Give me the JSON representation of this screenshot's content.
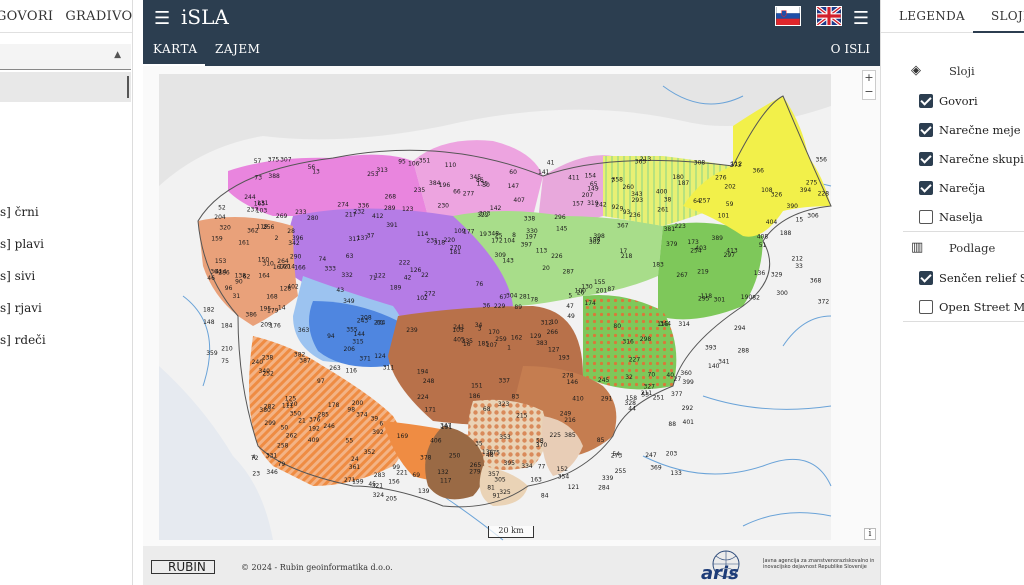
{
  "left_panel": {
    "tabs": [
      "GOVORI",
      "GRADIVO"
    ],
    "legend_items": [
      "s] črni",
      "s] plavi",
      "s] sivi",
      "s] rjavi",
      "s] rdeči"
    ]
  },
  "header": {
    "title": "iSLA",
    "tabs": [
      "KARTA",
      "ZAJEM"
    ],
    "about": "O ISLI"
  },
  "map": {
    "zoom_in": "+",
    "zoom_out": "−",
    "scale_label": "20 km",
    "info": "i",
    "region_colors": {
      "pink": "#e879dc",
      "violet": "#b57ce6",
      "blue": "#4f86e0",
      "lightblue": "#9cc3f0",
      "green": "#7ec85a",
      "lightgreen": "#a8dd8a",
      "yellow": "#f2f04a",
      "brown": "#b8714a",
      "orange": "#ef8c43",
      "salmon": "#e9a17a",
      "tan": "#ead3b6",
      "darkbrown": "#9a6a45"
    },
    "points": [
      "1",
      "2",
      "3",
      "4",
      "5",
      "6",
      "7",
      "8",
      "9",
      "10",
      "13",
      "14",
      "15",
      "16",
      "17",
      "19",
      "20",
      "21",
      "22",
      "23",
      "24",
      "25",
      "26",
      "27",
      "28",
      "30",
      "31",
      "32",
      "33",
      "34",
      "35",
      "36",
      "37",
      "38",
      "39",
      "40",
      "41",
      "42",
      "43",
      "44",
      "45",
      "46",
      "47",
      "48",
      "49",
      "50",
      "51",
      "52",
      "53",
      "54",
      "55",
      "56",
      "57",
      "58",
      "59",
      "60",
      "61",
      "62",
      "63",
      "64",
      "65",
      "66",
      "67",
      "68",
      "69",
      "70",
      "71",
      "72",
      "73",
      "74",
      "75",
      "76",
      "77",
      "78",
      "79",
      "80",
      "81",
      "82",
      "83",
      "84",
      "85",
      "86",
      "87",
      "88",
      "89",
      "90",
      "91",
      "92",
      "93",
      "94",
      "95",
      "96",
      "97",
      "98",
      "99",
      "100",
      "101",
      "102",
      "103",
      "104",
      "105",
      "106",
      "107",
      "108",
      "109",
      "110",
      "111",
      "112",
      "113",
      "114",
      "115",
      "116",
      "117",
      "118",
      "119",
      "120",
      "121",
      "122",
      "123",
      "124",
      "125",
      "126",
      "127",
      "128",
      "129",
      "130",
      "131",
      "132",
      "133",
      "134",
      "135",
      "136",
      "137",
      "138",
      "139",
      "140",
      "141",
      "142",
      "143",
      "144",
      "145",
      "146",
      "147",
      "148",
      "149",
      "150",
      "151",
      "152",
      "153",
      "154",
      "155",
      "156",
      "157",
      "158",
      "159",
      "160",
      "161",
      "162",
      "163",
      "164",
      "165",
      "166",
      "167",
      "168",
      "169",
      "170",
      "171",
      "172",
      "173",
      "174",
      "175",
      "176",
      "177",
      "178",
      "179",
      "180",
      "181",
      "182",
      "183",
      "184",
      "185",
      "186",
      "187",
      "188",
      "189",
      "190",
      "191",
      "192",
      "193",
      "194",
      "195",
      "196",
      "197",
      "198",
      "199",
      "200",
      "201",
      "202",
      "203",
      "204",
      "205",
      "206",
      "207",
      "208",
      "209",
      "210",
      "211",
      "212",
      "213",
      "214",
      "215",
      "216",
      "217",
      "218",
      "219",
      "220",
      "221",
      "222",
      "223",
      "224",
      "225",
      "226",
      "227",
      "228",
      "229",
      "230",
      "231",
      "232",
      "233",
      "234",
      "235",
      "236",
      "237",
      "238",
      "239",
      "240",
      "241",
      "242",
      "243",
      "244",
      "245",
      "246",
      "247",
      "248",
      "249",
      "250",
      "251",
      "252",
      "253",
      "254",
      "255",
      "256",
      "257",
      "258",
      "259",
      "260",
      "261",
      "262",
      "263",
      "264",
      "265",
      "266",
      "267",
      "268",
      "269",
      "270",
      "271",
      "272",
      "273",
      "274",
      "275",
      "276",
      "277",
      "278",
      "279",
      "280",
      "281",
      "282",
      "283",
      "284",
      "285",
      "286",
      "287",
      "288",
      "289",
      "290",
      "291",
      "292",
      "293",
      "294",
      "295",
      "296",
      "297",
      "298",
      "299",
      "300",
      "301",
      "302",
      "303",
      "304",
      "305",
      "306",
      "307",
      "308",
      "309",
      "310",
      "311",
      "312",
      "313",
      "314",
      "315",
      "316",
      "317",
      "318",
      "319",
      "320",
      "321",
      "322",
      "323",
      "324",
      "325",
      "326",
      "327",
      "328",
      "329",
      "330",
      "331",
      "332",
      "333",
      "334",
      "335",
      "336",
      "337",
      "338",
      "339",
      "340",
      "341",
      "342",
      "343",
      "344",
      "345",
      "346",
      "347",
      "348",
      "349",
      "350",
      "351",
      "352",
      "353",
      "354",
      "355",
      "356",
      "357",
      "358",
      "359",
      "360",
      "361",
      "362",
      "363",
      "364",
      "365",
      "366",
      "367",
      "368",
      "369",
      "370",
      "371",
      "372",
      "373",
      "374",
      "375",
      "376",
      "377",
      "378",
      "379",
      "380",
      "381",
      "382",
      "383",
      "384",
      "385",
      "386",
      "387",
      "388",
      "389",
      "390",
      "391",
      "392",
      "393",
      "394",
      "395",
      "396",
      "397",
      "398",
      "399",
      "400",
      "401",
      "402",
      "403",
      "404",
      "405",
      "406",
      "407",
      "408",
      "409",
      "410",
      "411",
      "412",
      "413",
      "414"
    ]
  },
  "footer": {
    "logo": "RUBIN",
    "copyright": "© 2024 - Rubin geoinformatika d.o.o.",
    "aris_logo": "aris",
    "aris_text": "Javna agencija za znanstvenoraziskovalno in inovacijsko dejavnost Republike Slovenije"
  },
  "right_panel": {
    "tabs": [
      "LEGENDA",
      "SLOJI"
    ],
    "layers_header": "Sloji",
    "layers": [
      {
        "label": "Govori",
        "checked": true
      },
      {
        "label": "Narečne meje",
        "checked": true
      },
      {
        "label": "Narečne skupine",
        "checked": true
      },
      {
        "label": "Narečja",
        "checked": true
      },
      {
        "label": "Naselja",
        "checked": false
      }
    ],
    "base_header": "Podlage",
    "bases": [
      {
        "label": "Senčen relief Slovenije",
        "checked": true
      },
      {
        "label": "Open Street Map",
        "checked": false
      }
    ]
  }
}
